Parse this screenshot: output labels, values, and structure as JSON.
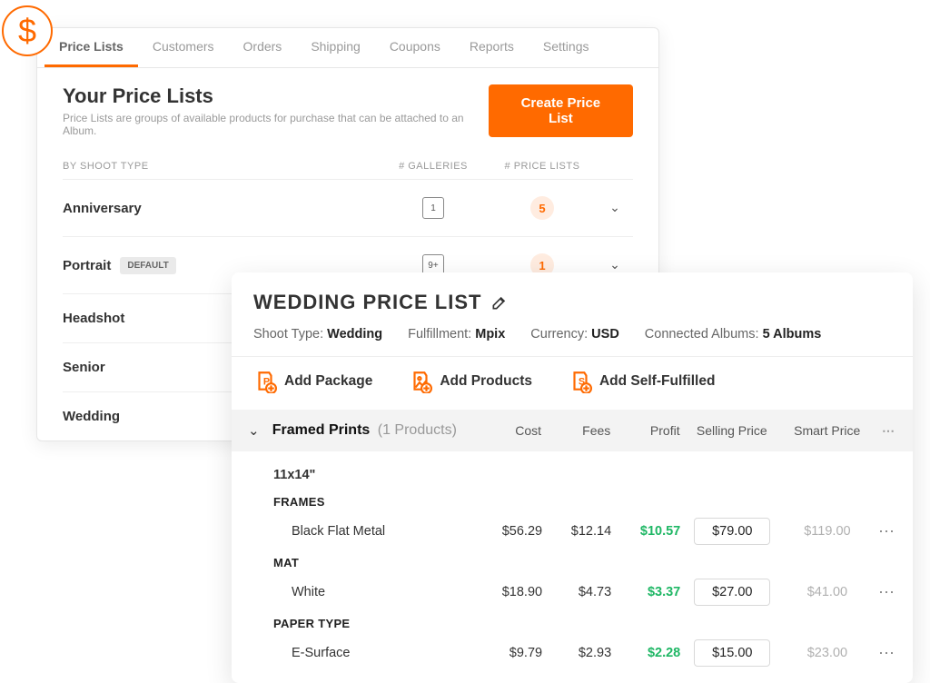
{
  "tabs": [
    "Price Lists",
    "Customers",
    "Orders",
    "Shipping",
    "Coupons",
    "Reports",
    "Settings"
  ],
  "page": {
    "title": "Your Price Lists",
    "sub": "Price Lists are groups of available products for purchase that can be attached to an Album.",
    "create_btn": "Create Price List"
  },
  "list_head": {
    "name": "BY SHOOT TYPE",
    "gal": "# GALLERIES",
    "pl": "# PRICE LISTS"
  },
  "shoots": [
    {
      "name": "Anniversary",
      "default": false,
      "galleries": "1",
      "priceLists": "5",
      "expand": true
    },
    {
      "name": "Portrait",
      "default": true,
      "galleries": "9+",
      "priceLists": "1",
      "expand": true
    },
    {
      "name": "Headshot",
      "default": false
    },
    {
      "name": "Senior",
      "default": false
    },
    {
      "name": "Wedding",
      "default": false
    }
  ],
  "default_badge": "DEFAULT",
  "wedding": {
    "title": "WEDDING PRICE LIST",
    "meta": {
      "shootType_label": "Shoot Type:",
      "shootType": "Wedding",
      "fulfill_label": "Fulfillment:",
      "fulfill": "Mpix",
      "currency_label": "Currency:",
      "currency": "USD",
      "albums_label": "Connected Albums:",
      "albums": "5 Albums"
    },
    "actions": {
      "pkg": "Add Package",
      "prod": "Add Products",
      "self": "Add Self-Fulfilled"
    },
    "group": {
      "name": "Framed Prints",
      "count": "(1 Products)"
    },
    "cols": {
      "cost": "Cost",
      "fees": "Fees",
      "profit": "Profit",
      "sell": "Selling Price",
      "smart": "Smart Price"
    },
    "size": "11x14\"",
    "cats": [
      "FRAMES",
      "MAT",
      "PAPER TYPE"
    ],
    "rows": [
      {
        "name": "Black Flat Metal",
        "cost": "$56.29",
        "fees": "$12.14",
        "profit": "$10.57",
        "sell": "$79.00",
        "smart": "$119.00"
      },
      {
        "name": "White",
        "cost": "$18.90",
        "fees": "$4.73",
        "profit": "$3.37",
        "sell": "$27.00",
        "smart": "$41.00"
      },
      {
        "name": "E-Surface",
        "cost": "$9.79",
        "fees": "$2.93",
        "profit": "$2.28",
        "sell": "$15.00",
        "smart": "$23.00"
      }
    ]
  }
}
